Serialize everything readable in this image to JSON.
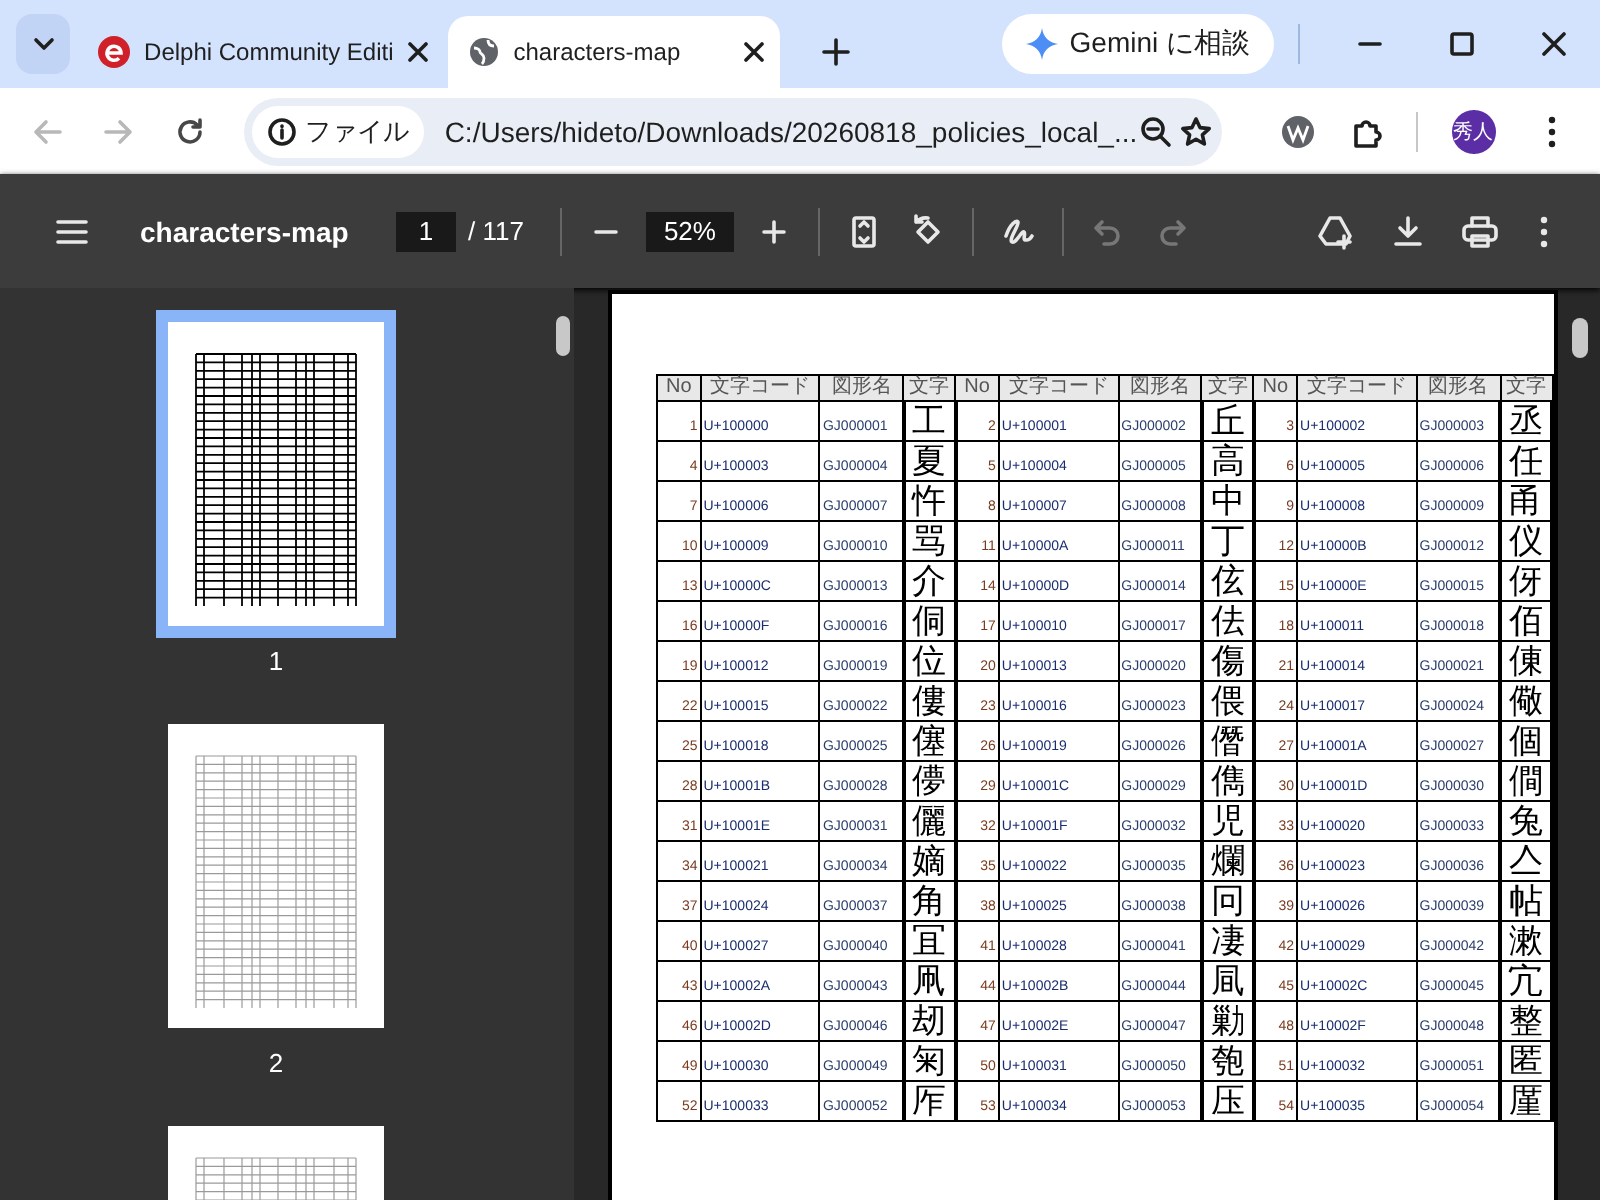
{
  "browser": {
    "tabs": [
      {
        "title": "Delphi Community Editi",
        "selected": false
      },
      {
        "title": "characters-map",
        "selected": true
      }
    ],
    "gemini_button": "Gemini に相談",
    "nav_buttons": [
      {
        "kind": "back",
        "disabled": true
      },
      {
        "kind": "forward",
        "disabled": true
      },
      {
        "kind": "reload",
        "disabled": false
      }
    ],
    "address": {
      "chip": "ファイル",
      "url": "C:/Users/hideto/Downloads/20260818_policies_local_..."
    },
    "profile": "秀人"
  },
  "pdf_toolbar": {
    "title": "characters-map",
    "page": "1",
    "page_count": "/ 117",
    "zoom": "52%",
    "history_buttons": [
      {
        "kind": "undo",
        "disabled": true
      },
      {
        "kind": "redo",
        "disabled": true
      }
    ]
  },
  "thumbnails": [
    {
      "label": "1",
      "selected": true
    },
    {
      "label": "2",
      "selected": false
    },
    {
      "selected": false
    }
  ],
  "table": {
    "columns": [
      "No",
      "文字コード",
      "図形名",
      "文字",
      "No",
      "文字コード",
      "図形名",
      "文字",
      "No",
      "文字コード",
      "図形名",
      "文字"
    ],
    "rows": [
      [
        "1",
        "U+100000",
        "GJ000001",
        "工",
        "2",
        "U+100001",
        "GJ000002",
        "丘",
        "3",
        "U+100002",
        "GJ000003",
        "丞"
      ],
      [
        "4",
        "U+100003",
        "GJ000004",
        "夏",
        "5",
        "U+100004",
        "GJ000005",
        "高",
        "6",
        "U+100005",
        "GJ000006",
        "任"
      ],
      [
        "7",
        "U+100006",
        "GJ000007",
        "忤",
        "8",
        "U+100007",
        "GJ000008",
        "中",
        "9",
        "U+100008",
        "GJ000009",
        "甬"
      ],
      [
        "10",
        "U+100009",
        "GJ000010",
        "骂",
        "11",
        "U+10000A",
        "GJ000011",
        "丁",
        "12",
        "U+10000B",
        "GJ000012",
        "仪"
      ],
      [
        "13",
        "U+10000C",
        "GJ000013",
        "介",
        "14",
        "U+10000D",
        "GJ000014",
        "伭",
        "15",
        "U+10000E",
        "GJ000015",
        "伢"
      ],
      [
        "16",
        "U+10000F",
        "GJ000016",
        "侗",
        "17",
        "U+100010",
        "GJ000017",
        "佉",
        "18",
        "U+100011",
        "GJ000018",
        "佰"
      ],
      [
        "19",
        "U+100012",
        "GJ000019",
        "位",
        "20",
        "U+100013",
        "GJ000020",
        "傷",
        "21",
        "U+100014",
        "GJ000021",
        "倲"
      ],
      [
        "22",
        "U+100015",
        "GJ000022",
        "僂",
        "23",
        "U+100016",
        "GJ000023",
        "偎",
        "24",
        "U+100017",
        "GJ000024",
        "儆"
      ],
      [
        "25",
        "U+100018",
        "GJ000025",
        "僿",
        "26",
        "U+100019",
        "GJ000026",
        "僭",
        "27",
        "U+10001A",
        "GJ000027",
        "個"
      ],
      [
        "28",
        "U+10001B",
        "GJ000028",
        "儚",
        "29",
        "U+10001C",
        "GJ000029",
        "儁",
        "30",
        "U+10001D",
        "GJ000030",
        "僴"
      ],
      [
        "31",
        "U+10001E",
        "GJ000031",
        "儷",
        "32",
        "U+10001F",
        "GJ000032",
        "児",
        "33",
        "U+100020",
        "GJ000033",
        "兔"
      ],
      [
        "34",
        "U+100021",
        "GJ000034",
        "嫡",
        "35",
        "U+100022",
        "GJ000035",
        "爛",
        "36",
        "U+100023",
        "GJ000036",
        "亼"
      ],
      [
        "37",
        "U+100024",
        "GJ000037",
        "角",
        "38",
        "U+100025",
        "GJ000038",
        "冋",
        "39",
        "U+100026",
        "GJ000039",
        "帖"
      ],
      [
        "40",
        "U+100027",
        "GJ000040",
        "冝",
        "41",
        "U+100028",
        "GJ000041",
        "凄",
        "42",
        "U+100029",
        "GJ000042",
        "漱"
      ],
      [
        "43",
        "U+10002A",
        "GJ000043",
        "凧",
        "44",
        "U+10002B",
        "GJ000044",
        "凬",
        "45",
        "U+10002C",
        "GJ000045",
        "宂"
      ],
      [
        "46",
        "U+10002D",
        "GJ000046",
        "刼",
        "47",
        "U+10002E",
        "GJ000047",
        "勦",
        "48",
        "U+10002F",
        "GJ000048",
        "整"
      ],
      [
        "49",
        "U+100030",
        "GJ000049",
        "匊",
        "50",
        "U+100031",
        "GJ000050",
        "匏",
        "51",
        "U+100032",
        "GJ000051",
        "匿"
      ],
      [
        "52",
        "U+100033",
        "GJ000052",
        "厏",
        "53",
        "U+100034",
        "GJ000053",
        "压",
        "54",
        "U+100035",
        "GJ000054",
        "厪"
      ]
    ]
  }
}
